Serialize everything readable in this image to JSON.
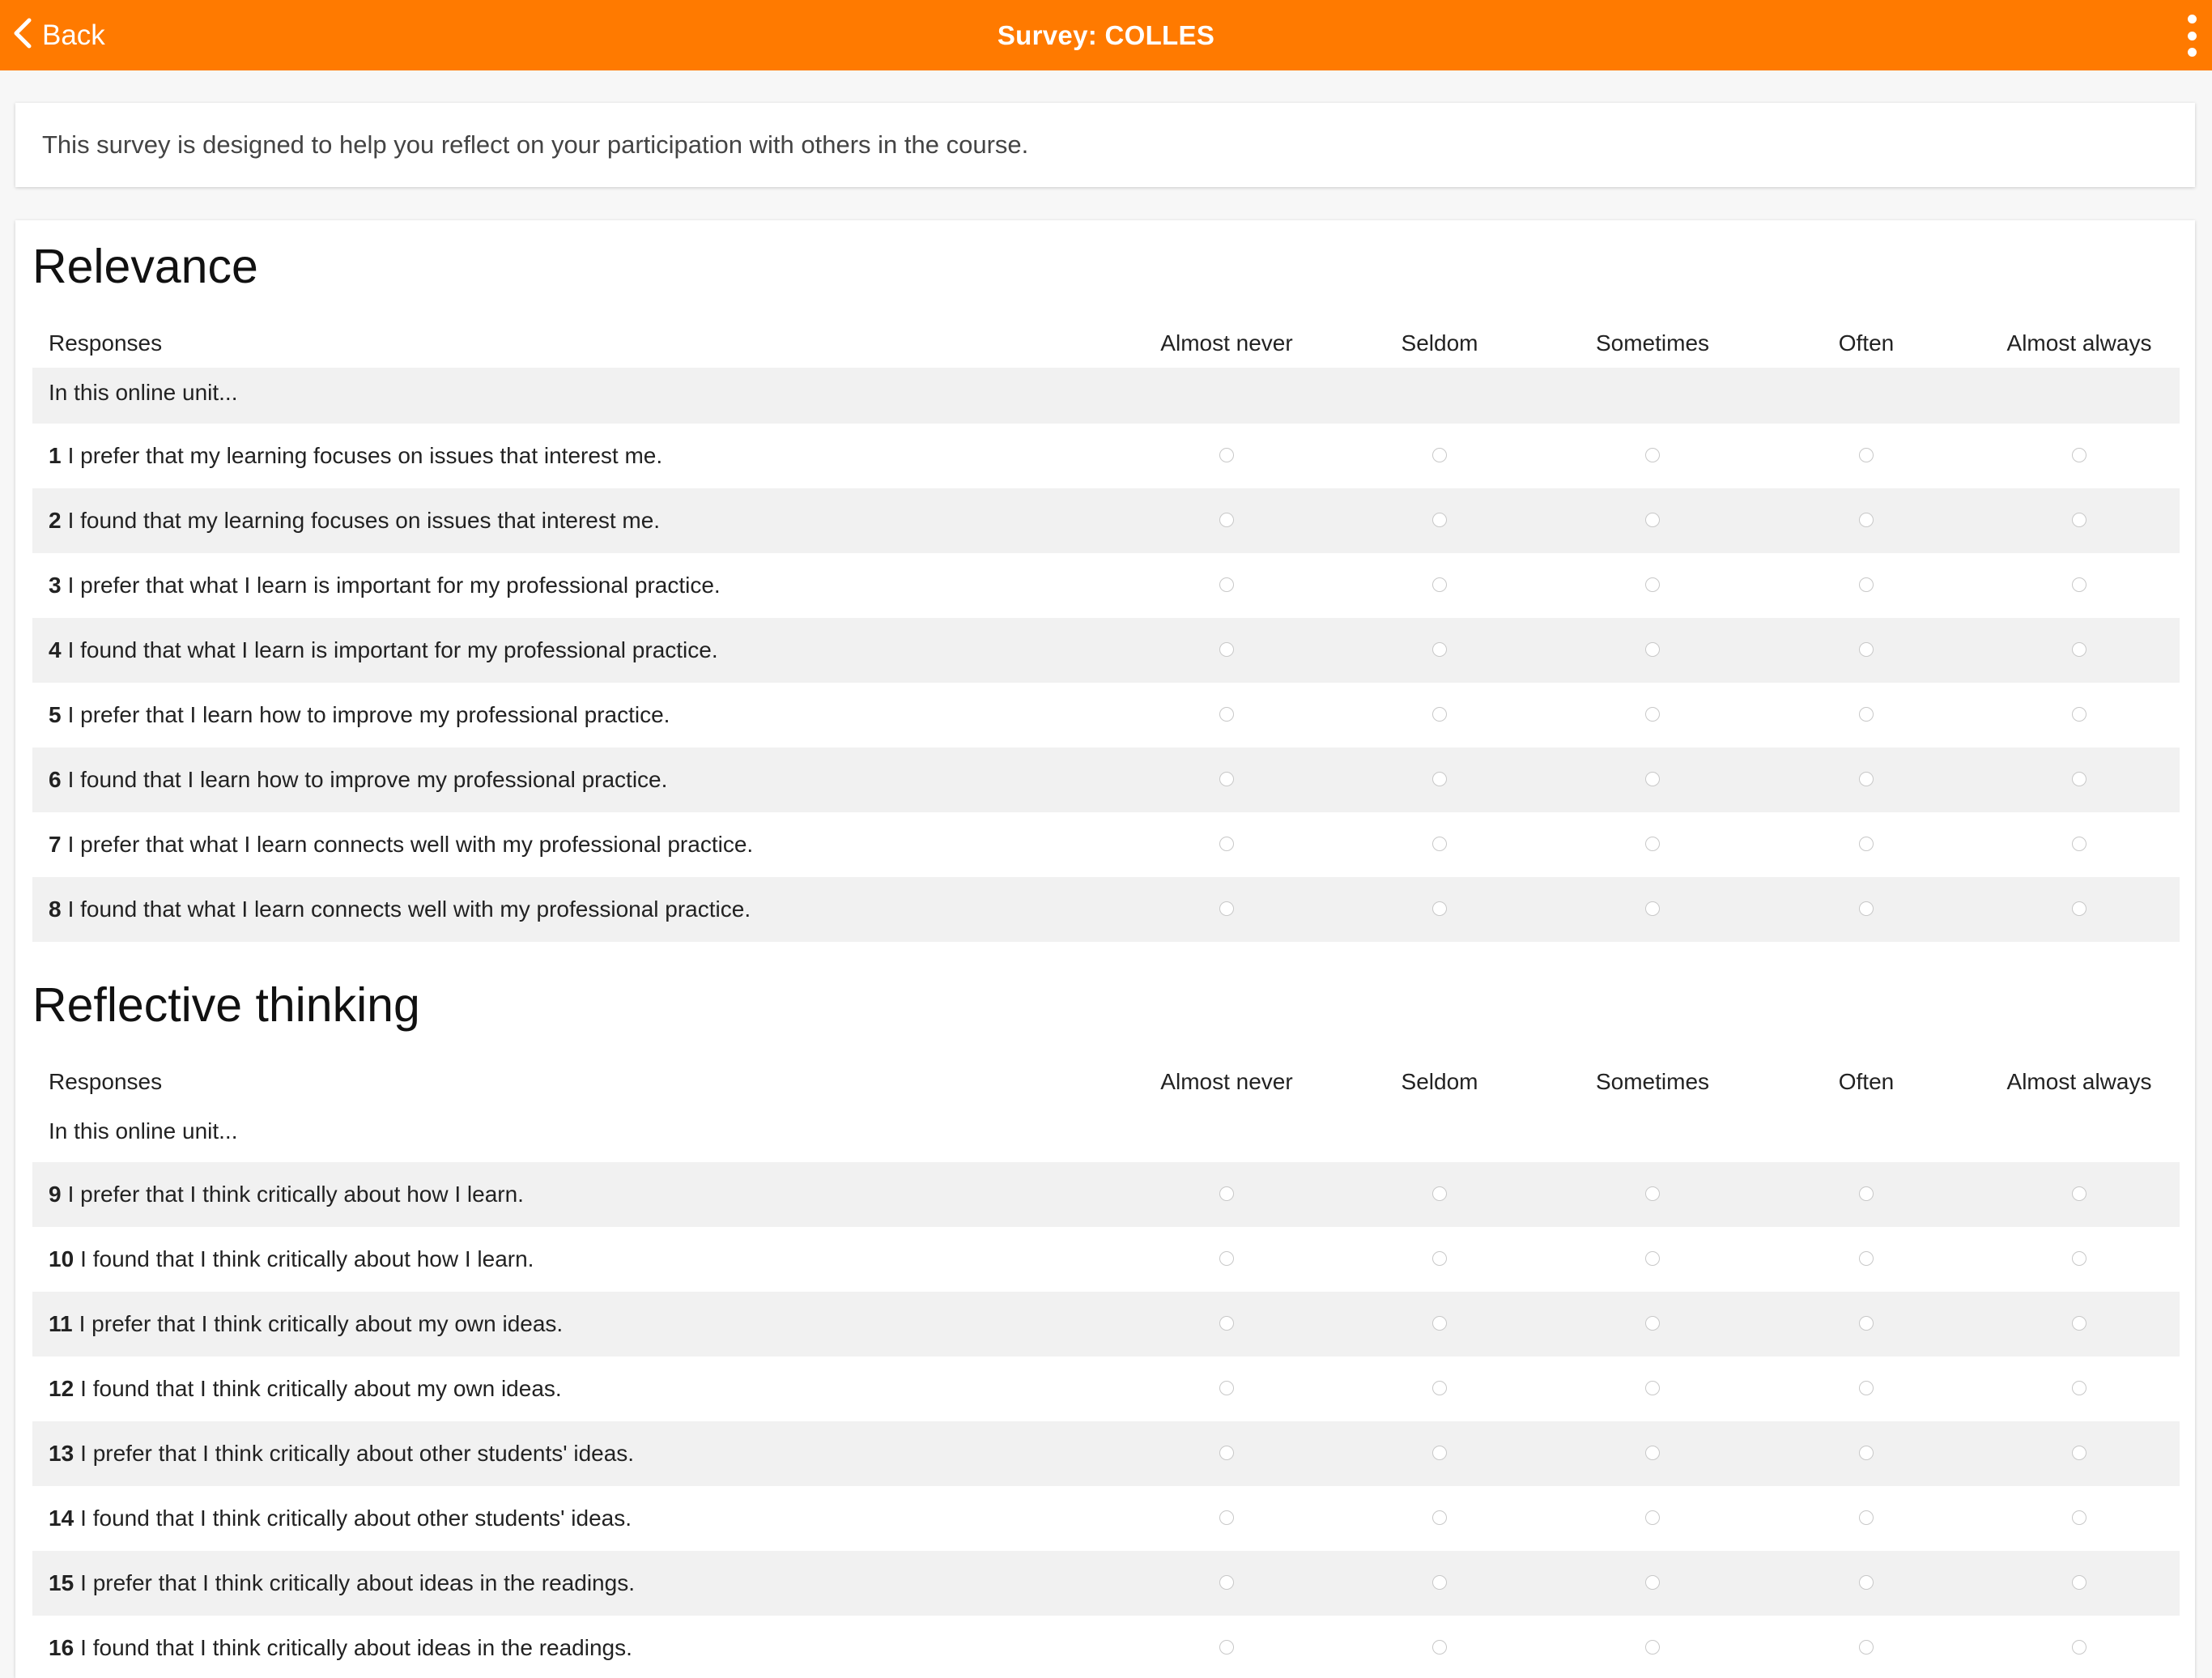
{
  "header": {
    "back_label": "Back",
    "title": "Survey: COLLES",
    "accent_color": "#ff7a00",
    "back_icon": "chevron-left-icon",
    "more_icon": "more-vertical-icon"
  },
  "intro": {
    "text": "This survey is designed to help you reflect on your participation with others in the course."
  },
  "sections": [
    {
      "title": "Relevance",
      "responses_label": "Responses",
      "columns": [
        "Almost never",
        "Seldom",
        "Sometimes",
        "Often",
        "Almost always"
      ],
      "unit_label": "In this online unit...",
      "questions": [
        {
          "num": "1",
          "text": "I prefer that my learning focuses on issues that interest me."
        },
        {
          "num": "2",
          "text": "I found that my learning focuses on issues that interest me."
        },
        {
          "num": "3",
          "text": "I prefer that what I learn is important for my professional practice."
        },
        {
          "num": "4",
          "text": "I found that what I learn is important for my professional practice."
        },
        {
          "num": "5",
          "text": "I prefer that I learn how to improve my professional practice."
        },
        {
          "num": "6",
          "text": "I found that I learn how to improve my professional practice."
        },
        {
          "num": "7",
          "text": "I prefer that what I learn connects well with my professional practice."
        },
        {
          "num": "8",
          "text": "I found that what I learn connects well with my professional practice."
        }
      ]
    },
    {
      "title": "Reflective thinking",
      "responses_label": "Responses",
      "columns": [
        "Almost never",
        "Seldom",
        "Sometimes",
        "Often",
        "Almost always"
      ],
      "unit_label": "In this online unit...",
      "questions": [
        {
          "num": "9",
          "text": "I prefer that I think critically about how I learn."
        },
        {
          "num": "10",
          "text": "I found that I think critically about how I learn."
        },
        {
          "num": "11",
          "text": "I prefer that I think critically about my own ideas."
        },
        {
          "num": "12",
          "text": "I found that I think critically about my own ideas."
        },
        {
          "num": "13",
          "text": "I prefer that I think critically about other students' ideas."
        },
        {
          "num": "14",
          "text": "I found that I think critically about other students' ideas."
        },
        {
          "num": "15",
          "text": "I prefer that I think critically about ideas in the readings."
        },
        {
          "num": "16",
          "text": "I found that I think critically about ideas in the readings."
        }
      ]
    }
  ]
}
